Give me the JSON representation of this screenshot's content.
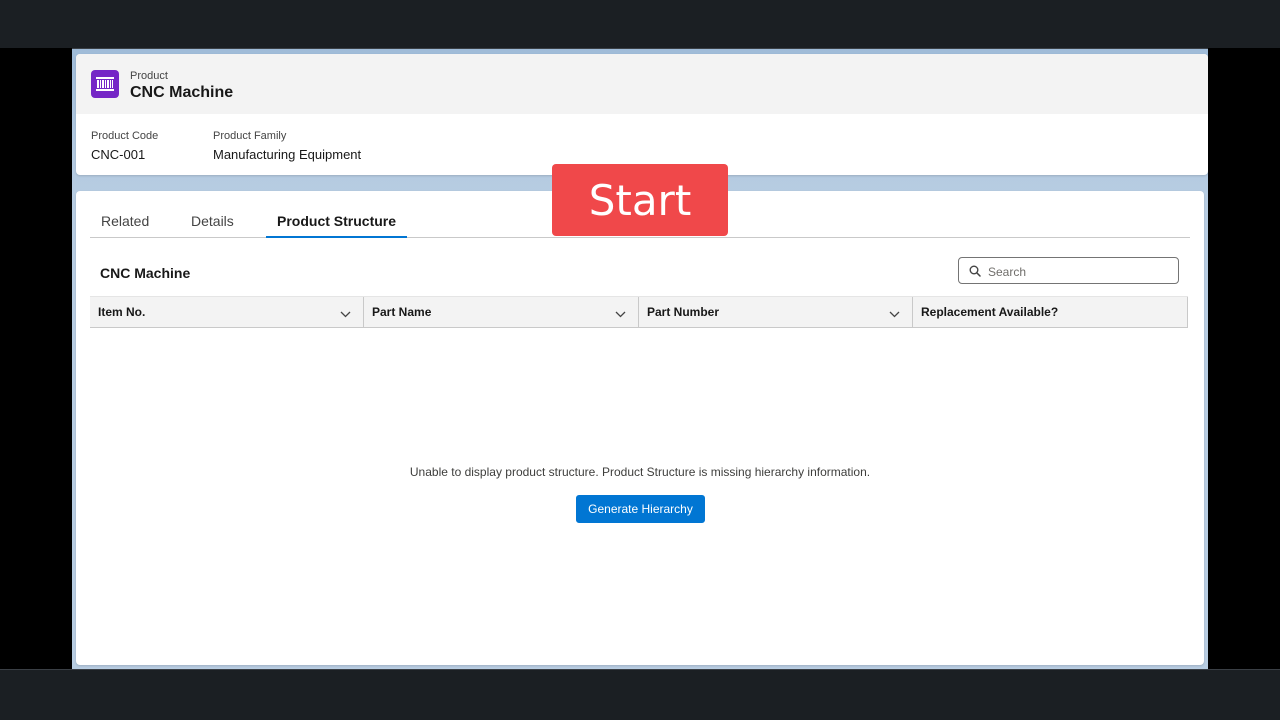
{
  "record": {
    "object_type": "Product",
    "title": "CNC Machine",
    "icon": "product-barcode-icon",
    "icon_color": "#7526C6",
    "fields": [
      {
        "label": "Product Code",
        "value": "CNC-001"
      },
      {
        "label": "Product Family",
        "value": "Manufacturing Equipment"
      }
    ]
  },
  "tabs": [
    {
      "label": "Related",
      "active": false
    },
    {
      "label": "Details",
      "active": false
    },
    {
      "label": "Product Structure",
      "active": true
    }
  ],
  "structure": {
    "title": "CNC Machine",
    "search_placeholder": "Search",
    "columns": [
      "Item No.",
      "Part Name",
      "Part Number",
      "Replacement Available?"
    ],
    "empty_message": "Unable to display product structure. Product Structure is missing hierarchy information.",
    "generate_button": "Generate Hierarchy"
  },
  "overlay": {
    "start_label": "Start",
    "color": "#F0484A"
  },
  "colors": {
    "brand_blue": "#0176D3"
  }
}
